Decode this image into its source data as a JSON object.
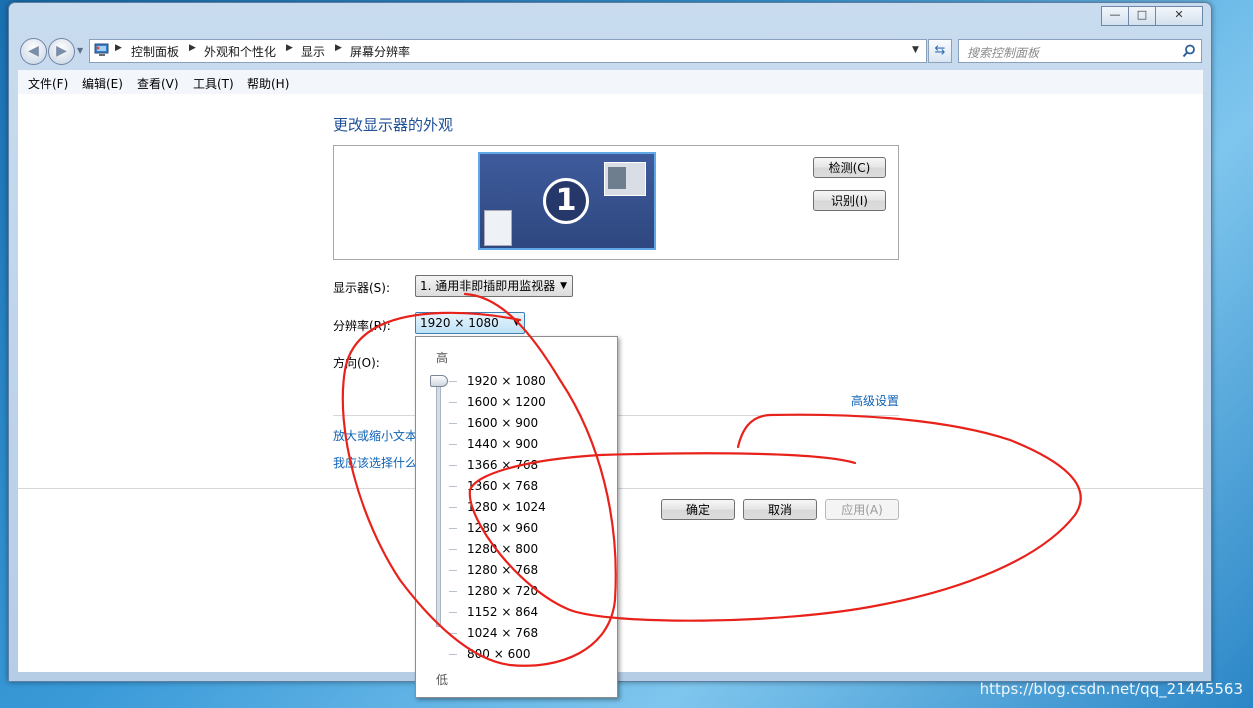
{
  "window": {
    "minimize_glyph": "—",
    "maximize_glyph": "□",
    "close_glyph": "✕"
  },
  "nav": {
    "back_glyph": "◀",
    "forward_glyph": "▶",
    "breadcrumb": [
      "控制面板",
      "外观和个性化",
      "显示",
      "屏幕分辨率"
    ],
    "search_placeholder": "搜索控制面板"
  },
  "menu": [
    "文件(F)",
    "编辑(E)",
    "查看(V)",
    "工具(T)",
    "帮助(H)"
  ],
  "page": {
    "title": "更改显示器的外观",
    "monitor_number": "1",
    "detect_button": "检测(C)",
    "identify_button": "识别(I)",
    "display_label": "显示器(S):",
    "display_value": "1. 通用非即插即用监视器",
    "resolution_label": "分辨率(R):",
    "resolution_value": "1920 × 1080",
    "orientation_label": "方向(O):",
    "advanced_link": "高级设置",
    "link_text_size": "放大或缩小文本",
    "link_what_to_choose": "我应该选择什么",
    "ok_button": "确定",
    "cancel_button": "取消",
    "apply_button": "应用(A)"
  },
  "dropdown": {
    "high_label": "高",
    "low_label": "低",
    "selected_index": 0,
    "resolutions": [
      "1920 × 1080",
      "1600 × 1200",
      "1600 × 900",
      "1440 × 900",
      "1366 × 768",
      "1360 × 768",
      "1280 × 1024",
      "1280 × 960",
      "1280 × 800",
      "1280 × 768",
      "1280 × 720",
      "1152 × 864",
      "1024 × 768",
      "800 × 600"
    ]
  },
  "watermark": "https://blog.csdn.net/qq_21445563",
  "colors": {
    "link": "#0f63b6",
    "annotation": "#e8221b"
  }
}
